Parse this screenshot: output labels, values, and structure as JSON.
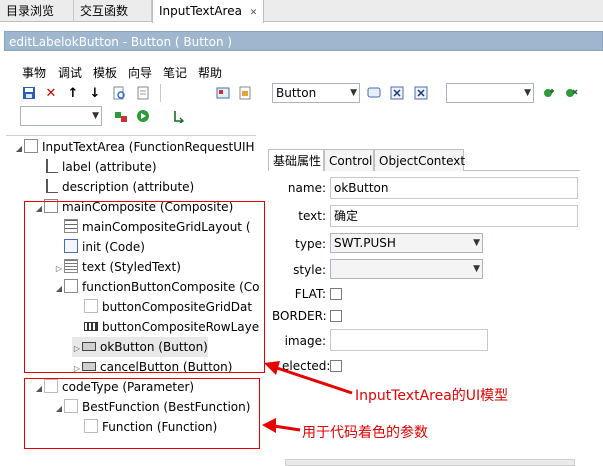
{
  "tabs": [
    {
      "label": "目录浏览"
    },
    {
      "label": "交互函数"
    },
    {
      "label": "InputTextArea",
      "close": "✕"
    }
  ],
  "window_title": "editLabelokButton - Button ( Button )",
  "menu": [
    "事物",
    "调试",
    "模板",
    "向导",
    "笔记",
    "帮助"
  ],
  "toolbar": {
    "type_combo": "Button",
    "right_combo": ""
  },
  "tree": [
    {
      "label": "InputTextArea (FunctionRequestUIH"
    },
    {
      "label": "label (attribute)"
    },
    {
      "label": "description (attribute)"
    },
    {
      "label": "mainComposite (Composite)"
    },
    {
      "label": "mainCompositeGridLayout ("
    },
    {
      "label": "init (Code)"
    },
    {
      "label": "text (StyledText)"
    },
    {
      "label": "functionButtonComposite (Co"
    },
    {
      "label": "buttonCompositeGridDat"
    },
    {
      "label": "buttonCompositeRowLaye"
    },
    {
      "label": "okButton (Button)"
    },
    {
      "label": "cancelButton (Button)"
    },
    {
      "label": "codeType (Parameter)"
    },
    {
      "label": "BestFunction (BestFunction)"
    },
    {
      "label": "Function (Function)"
    }
  ],
  "prop_tabs": [
    "基础属性",
    "Control",
    "ObjectContext"
  ],
  "props": {
    "name_label": "name:",
    "name_value": "okButton",
    "text_label": "text:",
    "text_value": "确定",
    "type_label": "type:",
    "type_value": "SWT.PUSH",
    "style_label": "style:",
    "flat_label": "FLAT:",
    "border_label": "BORDER:",
    "image_label": "image:",
    "selected_label": "elected:"
  },
  "annotations": {
    "ui_model": "InputTextArea的UI模型",
    "params": "用于代码着色的参数"
  },
  "colors": {
    "title_bar": "#9fb6cf",
    "callout": "#e60000"
  }
}
